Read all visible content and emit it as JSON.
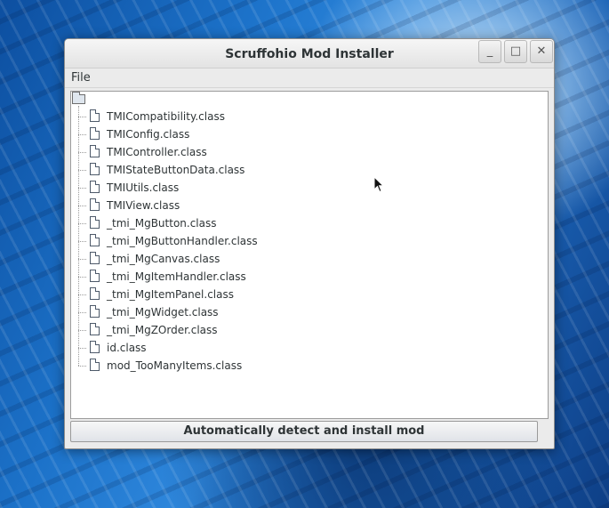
{
  "window": {
    "title": "Scruffohio Mod Installer",
    "controls": {
      "minimize": "_",
      "maximize": "□",
      "close": "✕"
    }
  },
  "menubar": {
    "file_label": "File"
  },
  "tree": {
    "root_icon": "folder-icon",
    "items": [
      "TMICompatibility.class",
      "TMIConfig.class",
      "TMIController.class",
      "TMIStateButtonData.class",
      "TMIUtils.class",
      "TMIView.class",
      "_tmi_MgButton.class",
      "_tmi_MgButtonHandler.class",
      "_tmi_MgCanvas.class",
      "_tmi_MgItemHandler.class",
      "_tmi_MgItemPanel.class",
      "_tmi_MgWidget.class",
      "_tmi_MgZOrder.class",
      "id.class",
      "mod_TooManyItems.class"
    ]
  },
  "install_button": {
    "label": "Automatically detect and install mod"
  }
}
